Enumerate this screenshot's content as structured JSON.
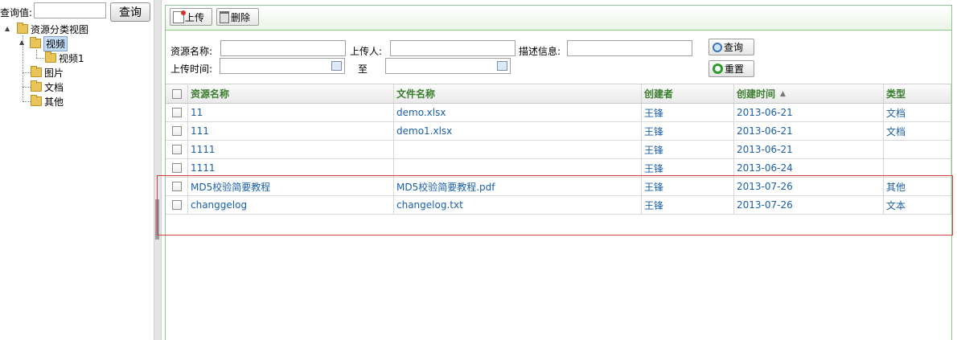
{
  "query": {
    "label": "查询值:",
    "value": "",
    "button": "查询"
  },
  "tree": {
    "root": "资源分类视图",
    "expander_expanded": "▲",
    "nodes": [
      {
        "label": "视频",
        "selected": true,
        "children": [
          {
            "label": "视频1"
          }
        ]
      },
      {
        "label": "图片"
      },
      {
        "label": "文档"
      },
      {
        "label": "其他"
      }
    ]
  },
  "toolbar": {
    "upload": "上传",
    "delete": "删除"
  },
  "search": {
    "name_label": "资源名称:",
    "uploader_label": "上传人:",
    "desc_label": "描述信息:",
    "time_label": "上传时间:",
    "to_label": "至",
    "search_btn": "查询",
    "reset_btn": "重置"
  },
  "grid": {
    "columns": [
      "资源名称",
      "文件名称",
      "创建者",
      "创建时间",
      "类型"
    ],
    "sort_indicator": "▲",
    "rows": [
      {
        "name": "11",
        "file": "demo.xlsx",
        "creator": "王锋",
        "time": "2013-06-21",
        "type": "文档"
      },
      {
        "name": "111",
        "file": "demo1.xlsx",
        "creator": "王锋",
        "time": "2013-06-21",
        "type": "文档"
      },
      {
        "name": "1111",
        "file": "",
        "creator": "王锋",
        "time": "2013-06-21",
        "type": ""
      },
      {
        "name": "1111",
        "file": "",
        "creator": "王锋",
        "time": "2013-06-24",
        "type": ""
      },
      {
        "name": "MD5校验简要教程",
        "file": "MD5校验简要教程.pdf",
        "creator": "王锋",
        "time": "2013-07-26",
        "type": "其他"
      },
      {
        "name": "changgelog",
        "file": "changelog.txt",
        "creator": "王锋",
        "time": "2013-07-26",
        "type": "文本"
      }
    ]
  },
  "colors": {
    "accent_green": "#3a7d2c",
    "link_blue": "#1a5fa8",
    "highlight_red": "#d34040"
  }
}
